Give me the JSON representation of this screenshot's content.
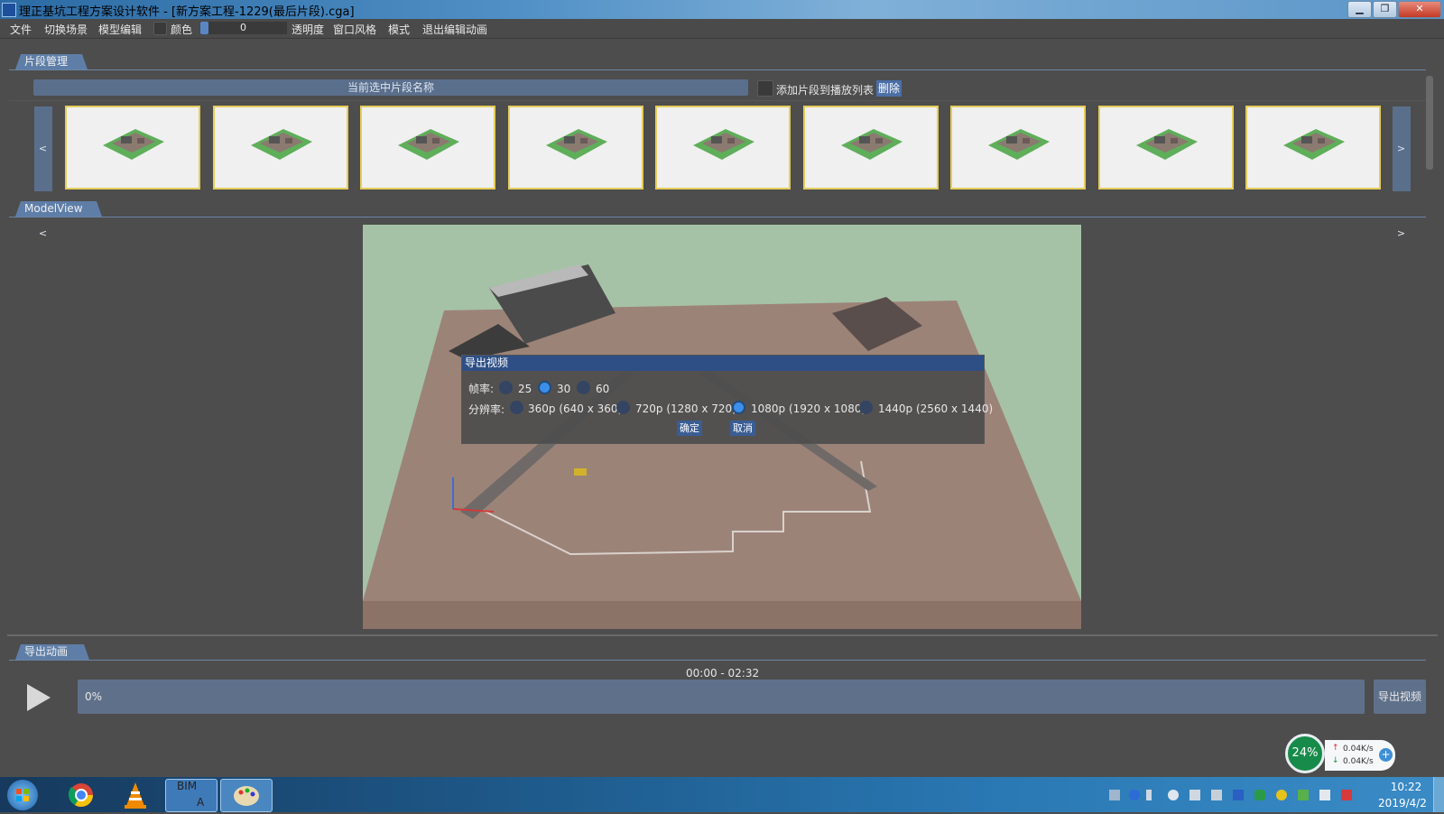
{
  "window": {
    "title": "理正基坑工程方案设计软件 - [新方案工程-1229(最后片段).cga]",
    "minimize": "▁",
    "maximize": "❐",
    "close": "✕"
  },
  "menu": {
    "file": "文件",
    "switch_scene": "切换场景",
    "model_edit": "模型编辑",
    "color": "颜色",
    "transparency_value": "0",
    "transparency": "透明度",
    "window_style": "窗口风格",
    "mode": "模式",
    "exit_edit": "退出编辑动画"
  },
  "clip_manager": {
    "tab": "片段管理",
    "current_clip_placeholder": "当前选中片段名称",
    "add_to_playlist": "添加片段到播放列表",
    "delete": "删除",
    "prev": "< <",
    "next": "> >",
    "thumbnail_count": 9
  },
  "model_view": {
    "tab": "ModelView"
  },
  "export_dialog": {
    "title": "导出视频",
    "frame_rate_label": "帧率:",
    "frame_rates": [
      "25",
      "30",
      "60"
    ],
    "selected_frame_rate": "30",
    "resolution_label": "分辨率:",
    "resolutions": [
      "360p (640 x 360)",
      "720p (1280 x 720)",
      "1080p (1920 x 1080)",
      "1440p (2560 x 1440)"
    ],
    "selected_resolution": "1080p (1920 x 1080)",
    "ok": "确定",
    "cancel": "取消"
  },
  "export_animation": {
    "tab": "导出动画",
    "time_range": "00:00 - 02:32",
    "progress_text": "0%",
    "progress": 0,
    "export_button": "导出视频"
  },
  "net_widget": {
    "percent": "24%",
    "upload": "0.04K/s",
    "download": "0.04K/s"
  },
  "taskbar": {
    "bim_label": "BIM",
    "bim_sub": "A",
    "time": "10:22",
    "date": "2019/4/2"
  },
  "colors": {
    "accent": "#5e7ea8",
    "dialog_title": "#2e4f86",
    "thumb_border": "#e4cd5a",
    "ground": "#9c8378",
    "sky": "#a5c2a6"
  }
}
